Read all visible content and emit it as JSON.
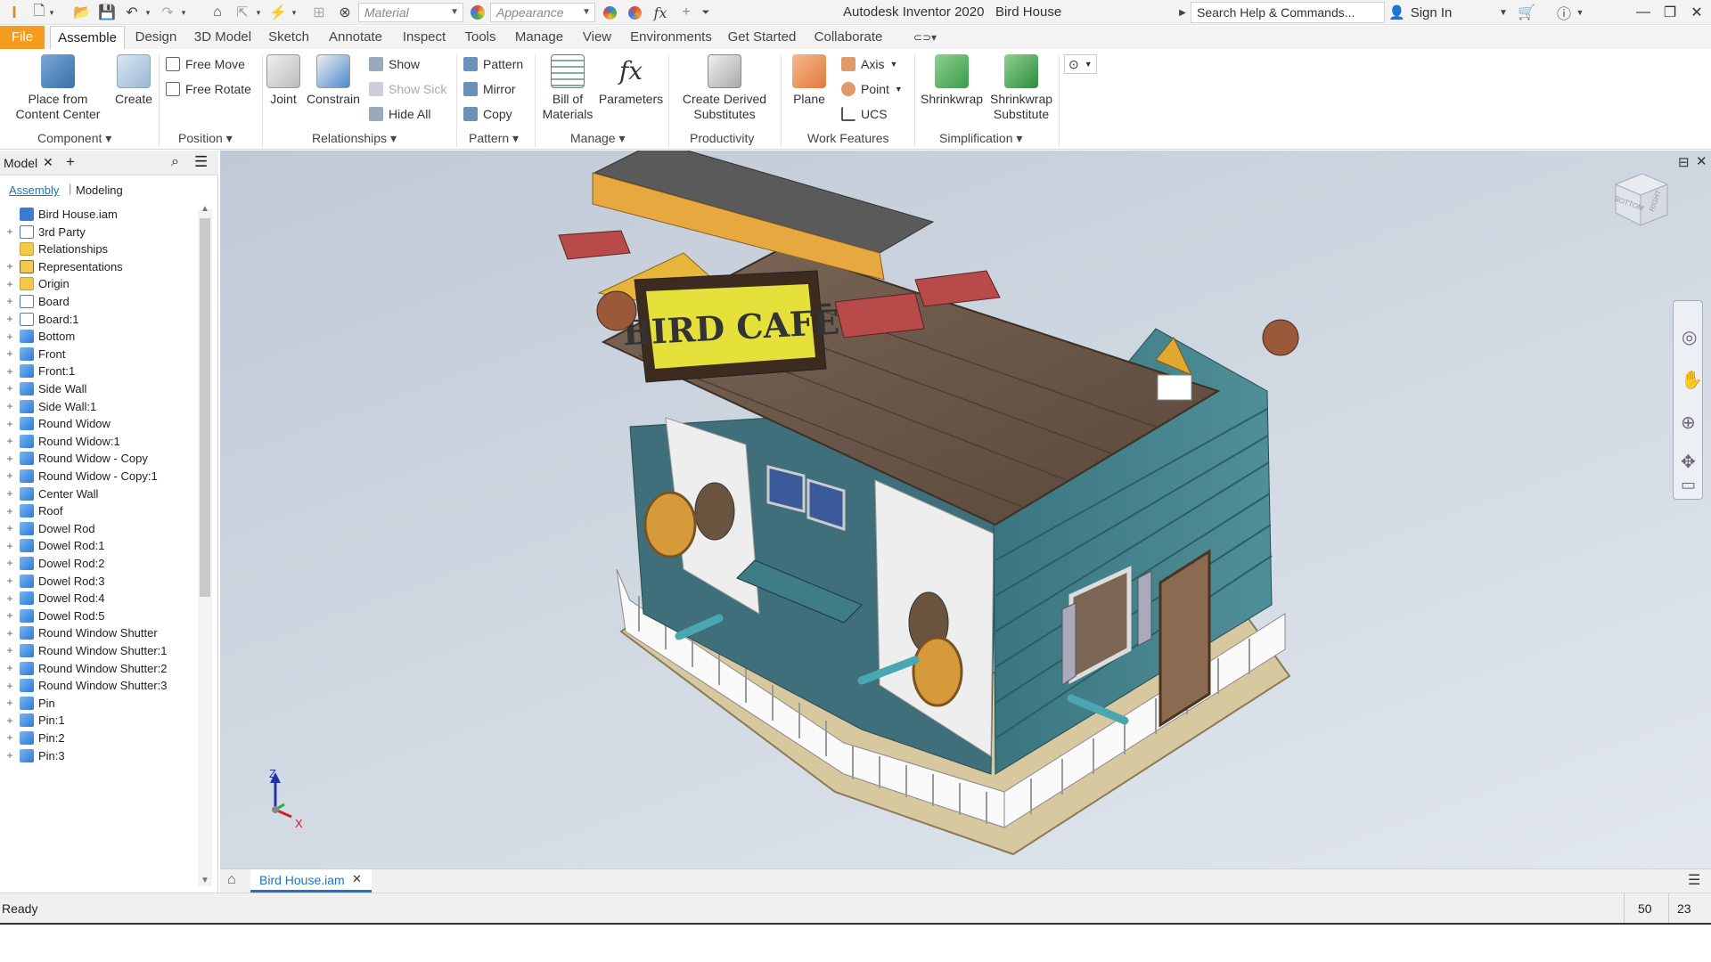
{
  "titlebar": {
    "app_title": "Autodesk Inventor 2020",
    "document": "Bird House",
    "material": "Material",
    "appearance": "Appearance",
    "search_placeholder": "Search Help & Commands...",
    "sign_in": "Sign In"
  },
  "menu_tabs": [
    "File",
    "Assemble",
    "Design",
    "3D Model",
    "Sketch",
    "Annotate",
    "Inspect",
    "Tools",
    "Manage",
    "View",
    "Environments",
    "Get Started",
    "Collaborate"
  ],
  "ribbon": {
    "place_from_content_center": [
      "Place from",
      "Content Center"
    ],
    "create": "Create",
    "free_move": "Free Move",
    "free_rotate": "Free Rotate",
    "joint": "Joint",
    "constrain": "Constrain",
    "show": "Show",
    "show_sick": "Show Sick",
    "hide_all": "Hide All",
    "pattern": "Pattern",
    "mirror": "Mirror",
    "copy": "Copy",
    "bill_of_materials": [
      "Bill of",
      "Materials"
    ],
    "parameters": "Parameters",
    "create_derived_substitutes": [
      "Create Derived",
      "Substitutes"
    ],
    "plane": "Plane",
    "axis": "Axis",
    "point": "Point",
    "ucs": "UCS",
    "shrinkwrap": "Shrinkwrap",
    "shrinkwrap_substitute": [
      "Shrinkwrap",
      "Substitute"
    ],
    "groups": {
      "component": "Component",
      "position": "Position",
      "relationships": "Relationships",
      "pattern": "Pattern",
      "manage": "Manage",
      "productivity": "Productivity",
      "work_features": "Work Features",
      "simplification": "Simplification"
    }
  },
  "browser": {
    "tab_label": "Model",
    "assembly_tab": "Assembly",
    "modeling_tab": "Modeling",
    "root": "Bird House.iam",
    "nodes": [
      "3rd Party",
      "Relationships",
      "Representations",
      "Origin",
      "Board",
      "Board:1",
      "Bottom",
      "Front",
      "Front:1",
      "Side Wall",
      "Side Wall:1",
      "Round Widow",
      "Round Widow:1",
      "Round Widow - Copy",
      "Round Widow - Copy:1",
      "Center Wall",
      "Roof",
      "Dowel Rod",
      "Dowel Rod:1",
      "Dowel Rod:2",
      "Dowel Rod:3",
      "Dowel Rod:4",
      "Dowel Rod:5",
      "Round Window Shutter",
      "Round Window Shutter:1",
      "Round Window Shutter:2",
      "Round Window Shutter:3",
      "Pin",
      "Pin:1",
      "Pin:2",
      "Pin:3"
    ]
  },
  "viewport": {
    "sign_text": "BIRD CAFĒ",
    "viewcube_labels": [
      "BOTTOM",
      "RIGHT"
    ],
    "axis_labels": {
      "z": "Z",
      "x": "X"
    }
  },
  "doc_tab": "Bird House.iam",
  "status": {
    "text": "Ready",
    "count_a": "50",
    "count_b": "23"
  },
  "colors": {
    "accent_orange": "#f59b1e",
    "accent_blue": "#1a73c9",
    "wall_teal": "#3e7d87",
    "roof_brown": "#6e5a4c",
    "sign_yellow": "#e5e13a"
  }
}
